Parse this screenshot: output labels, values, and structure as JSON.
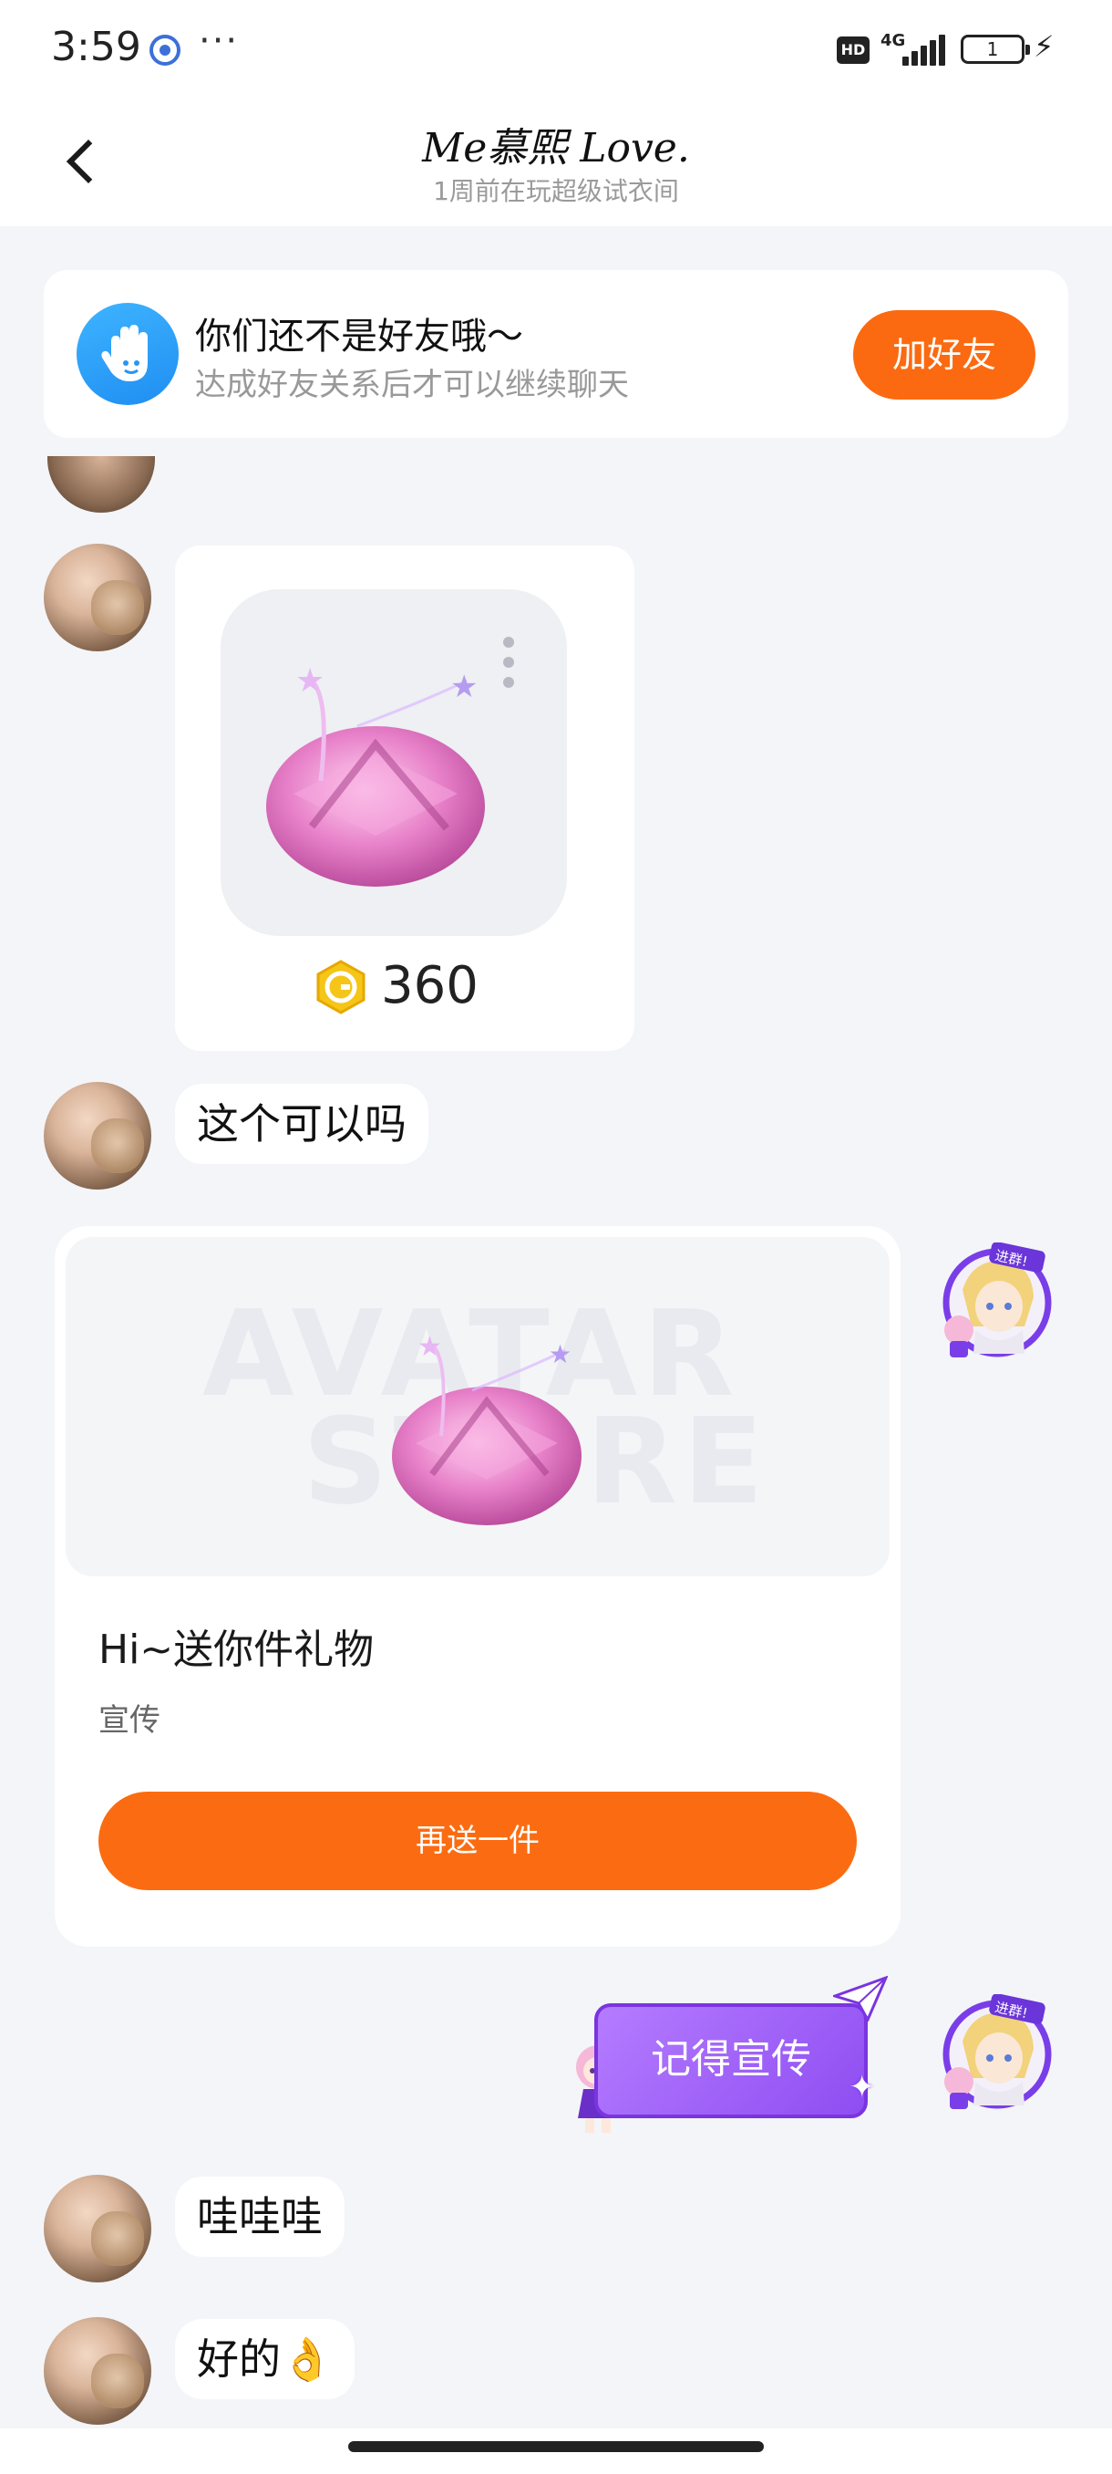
{
  "status_bar": {
    "time": "3:59",
    "more": "···",
    "hd": "HD",
    "network": "4G",
    "battery": "1"
  },
  "header": {
    "title": "Me慕熙 Love.",
    "subtitle": "1周前在玩超级试衣间",
    "back_icon": "chevron-left-icon"
  },
  "friend_banner": {
    "icon": "wave-hand-icon",
    "title": "你们还不是好友哦～",
    "subtitle": "达成好友关系后才可以继续聊天",
    "button": "加好友"
  },
  "messages": {
    "gift": {
      "price": "360",
      "coin_icon": "gold-coin-icon"
    },
    "text1": "这个可以吗",
    "promo": {
      "watermark_line1": "AVATAR",
      "watermark_line2": "STORE",
      "title": "Hi~送你件礼物",
      "tag": "宣传",
      "button": "再送一件"
    },
    "sticker_text": "记得宣传",
    "text2": "哇哇哇",
    "text3": "好的👌"
  },
  "colors": {
    "accent_orange": "#fb6a10",
    "sticker_purple": "#9a5cf5",
    "background": "#f3f5f8"
  }
}
